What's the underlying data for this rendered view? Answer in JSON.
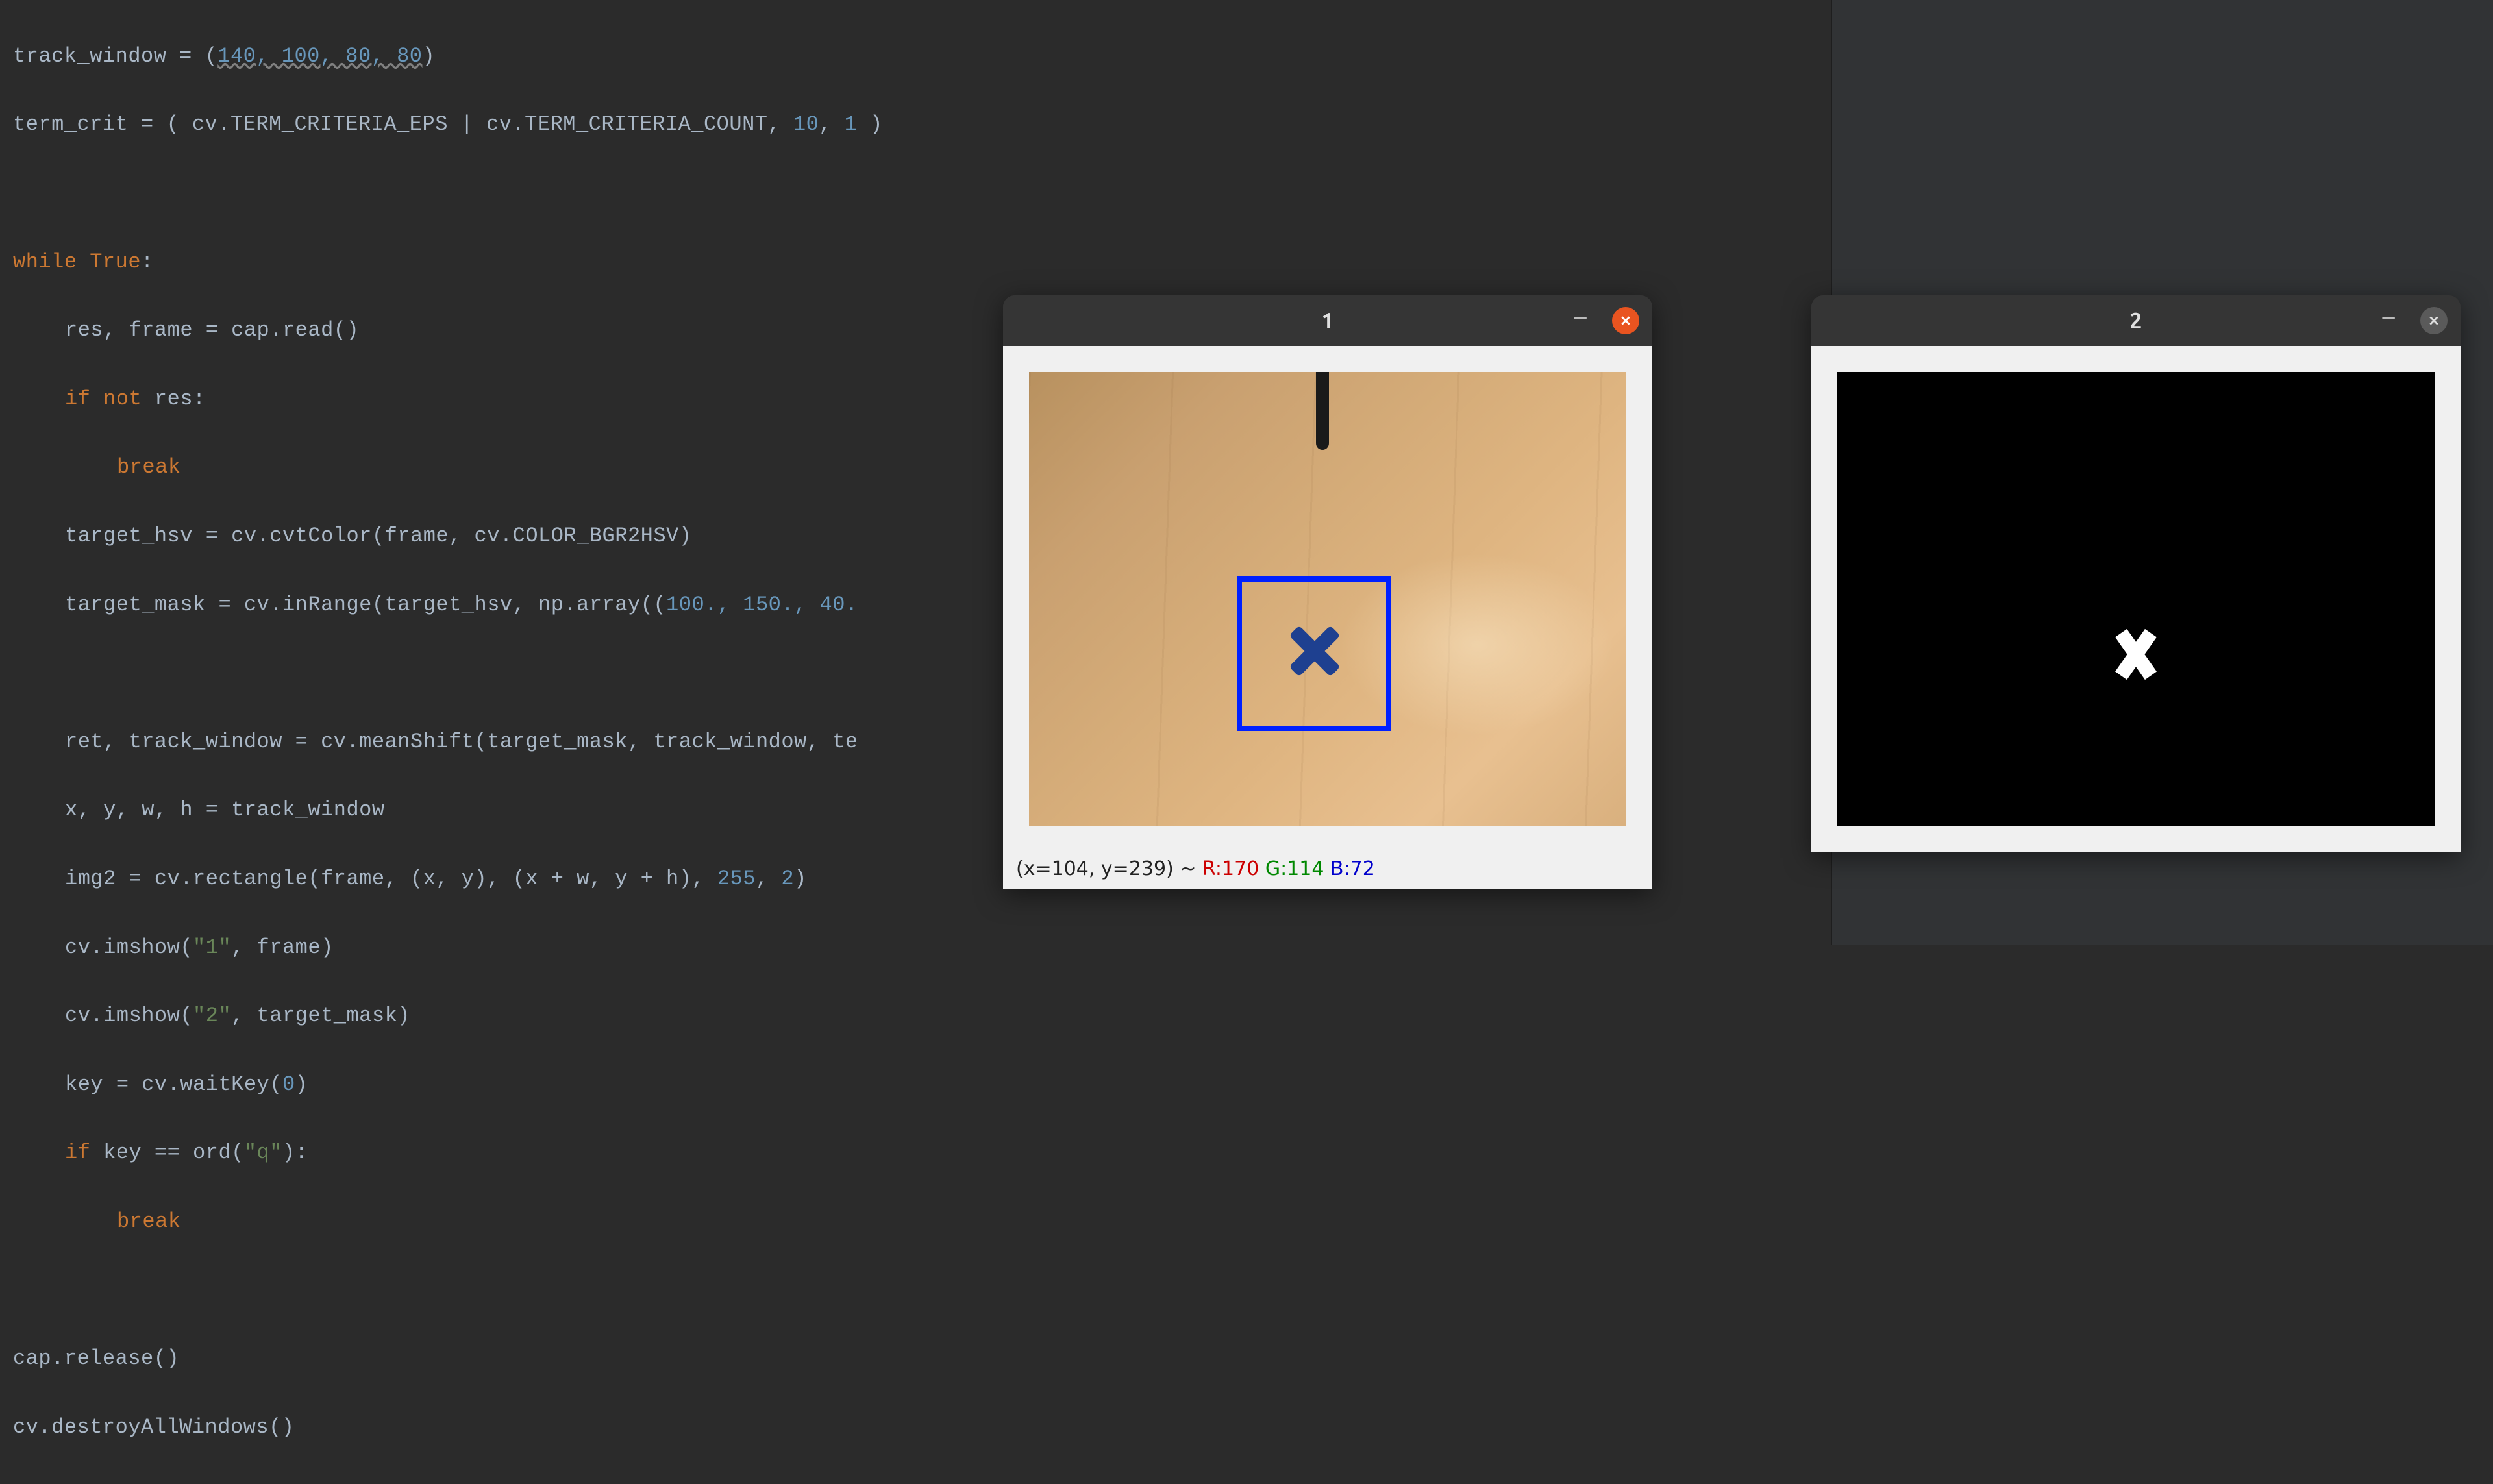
{
  "code": {
    "l1_a": "track_window = (",
    "l1_nums": "140, 100, 80, 80",
    "l1_b": ")",
    "l2_a": "term_crit = ( cv.TERM_CRITERIA_EPS | cv.TERM_CRITERIA_COUNT, ",
    "l2_n1": "10",
    "l2_c": ", ",
    "l2_n2": "1",
    "l2_b": " )",
    "l3_kw": "while ",
    "l3_true": "True",
    "l3_colon": ":",
    "l4": "res, frame = cap.read()",
    "l5_if": "if not ",
    "l5_b": "res:",
    "l6": "break",
    "l7": "target_hsv = cv.cvtColor(frame, cv.COLOR_BGR2HSV)",
    "l8_a": "target_mask = cv.inRange(target_hsv, np.array((",
    "l8_n": "100., 150., 40.",
    "l9_a": "ret, track_window = cv.meanShift(target_mask, track_window, te",
    "l10": "x, y, w, h = track_window",
    "l11_a": "img2 = cv.rectangle(frame, (x, y), (x + w, y + h), ",
    "l11_n1": "255",
    "l11_c": ", ",
    "l11_n2": "2",
    "l11_b": ")",
    "l12_a": "cv.imshow(",
    "l12_s": "\"1\"",
    "l12_b": ", frame)",
    "l13_a": "cv.imshow(",
    "l13_s": "\"2\"",
    "l13_b": ", target_mask)",
    "l14_a": "key = cv.waitKey(",
    "l14_n": "0",
    "l14_b": ")",
    "l15_if": "if ",
    "l15_a": "key == ord(",
    "l15_s": "\"q\"",
    "l15_b": "):",
    "l16": "break",
    "l17": "cap.release()",
    "l18": "cv.destroyAllWindows()"
  },
  "window1": {
    "title": "1",
    "status_coords": "(x=104, y=239) ~ ",
    "status_r": "R:170",
    "status_g": " G:114",
    "status_b": " B:72"
  },
  "window2": {
    "title": "2"
  }
}
